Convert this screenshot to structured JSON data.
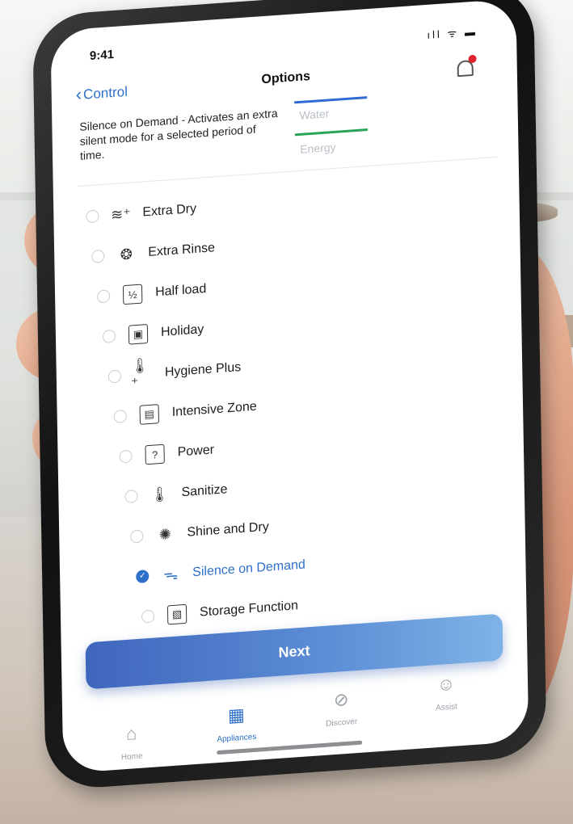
{
  "status_bar": {
    "time": "9:41",
    "icons": "ıll ᯤ ▬"
  },
  "nav": {
    "back_label": "Control",
    "title": "Options"
  },
  "description": "Silence on Demand - Activates an extra silent mode for a selected period of time.",
  "legend": {
    "water": "Water",
    "energy": "Energy",
    "water_color": "#2f6bd0",
    "energy_color": "#2aa35a"
  },
  "options": [
    {
      "label": "Extra Dry",
      "icon": "heat-waves-icon",
      "glyph": "≋⁺",
      "checked": false
    },
    {
      "label": "Extra Rinse",
      "icon": "rinse-icon",
      "glyph": "❂",
      "checked": false
    },
    {
      "label": "Half load",
      "icon": "half-load-icon",
      "glyph": "½",
      "checked": false
    },
    {
      "label": "Holiday",
      "icon": "holiday-icon",
      "glyph": "▣",
      "checked": false
    },
    {
      "label": "Hygiene Plus",
      "icon": "thermometer-plus-icon",
      "glyph": "🌡⁺",
      "checked": false
    },
    {
      "label": "Intensive Zone",
      "icon": "intensive-zone-icon",
      "glyph": "▤",
      "checked": false
    },
    {
      "label": "Power",
      "icon": "power-icon",
      "glyph": "?",
      "checked": false
    },
    {
      "label": "Sanitize",
      "icon": "thermometer-icon",
      "glyph": "🌡",
      "checked": false
    },
    {
      "label": "Shine and Dry",
      "icon": "shine-dry-icon",
      "glyph": "✺",
      "checked": false
    },
    {
      "label": "Silence on Demand",
      "icon": "silence-icon",
      "glyph": "ᯓ",
      "checked": true
    },
    {
      "label": "Storage Function",
      "icon": "storage-icon",
      "glyph": "▧",
      "checked": false
    }
  ],
  "next_button": "Next",
  "tabs": [
    {
      "label": "Home",
      "icon": "home-icon",
      "glyph": "⌂",
      "active": false
    },
    {
      "label": "Appliances",
      "icon": "appliances-icon",
      "glyph": "▦",
      "active": true
    },
    {
      "label": "Discover",
      "icon": "compass-icon",
      "glyph": "⊘",
      "active": false
    },
    {
      "label": "Assist",
      "icon": "smiley-icon",
      "glyph": "☺",
      "active": false
    }
  ],
  "colors": {
    "accent": "#2e6fc9",
    "notification": "#e0212f"
  }
}
